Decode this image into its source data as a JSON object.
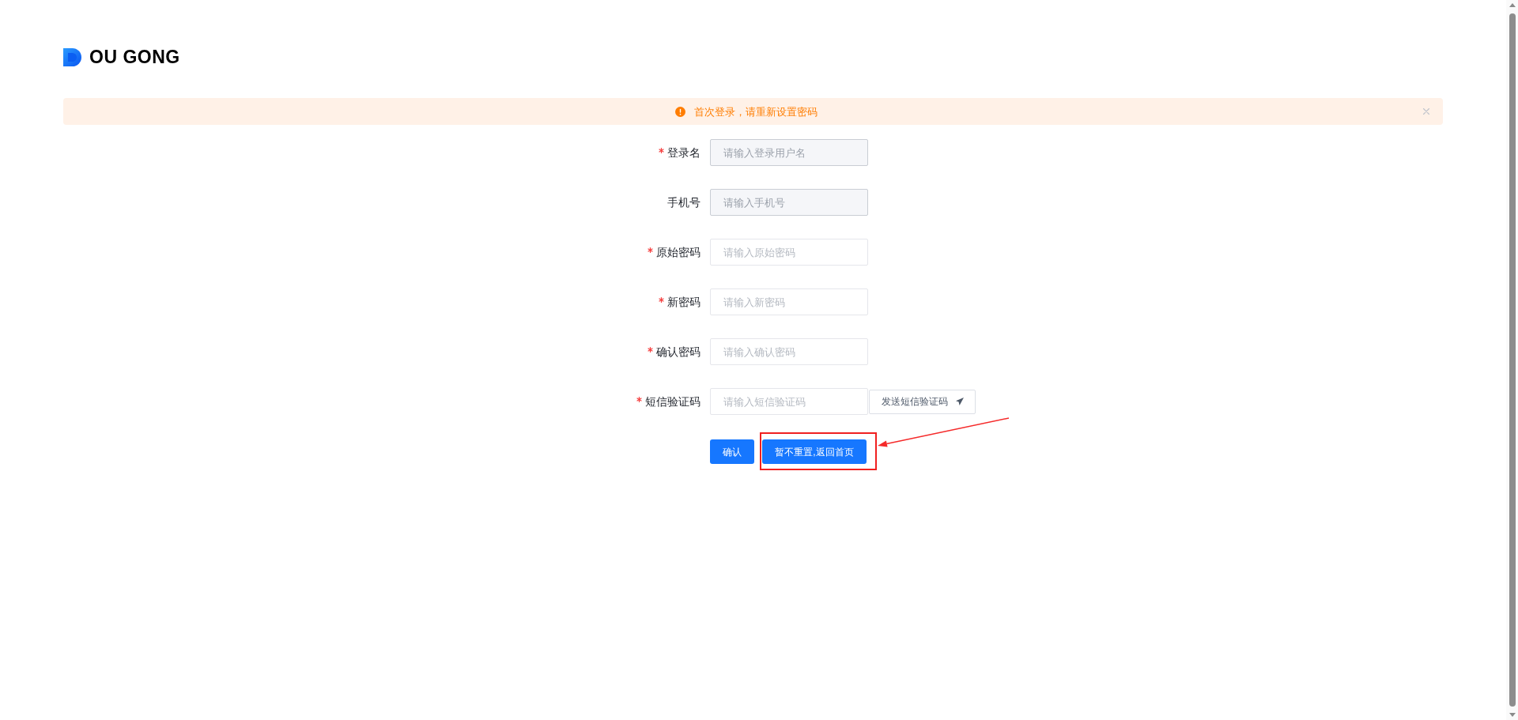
{
  "logo": {
    "text": "OU GONG"
  },
  "alert": {
    "message": "首次登录，请重新设置密码",
    "closable": true
  },
  "form": {
    "fields": [
      {
        "label": "登录名",
        "required": true,
        "disabled": true,
        "placeholder": "请输入登录用户名"
      },
      {
        "label": "手机号",
        "required": false,
        "disabled": true,
        "placeholder": "请输入手机号"
      },
      {
        "label": "原始密码",
        "required": true,
        "disabled": false,
        "placeholder": "请输入原始密码"
      },
      {
        "label": "新密码",
        "required": true,
        "disabled": false,
        "placeholder": "请输入新密码"
      },
      {
        "label": "确认密码",
        "required": true,
        "disabled": false,
        "placeholder": "请输入确认密码"
      },
      {
        "label": "短信验证码",
        "required": true,
        "disabled": false,
        "placeholder": "请输入短信验证码",
        "action": {
          "label": "发送短信验证码"
        }
      }
    ],
    "buttons": [
      {
        "label": "确认",
        "highlighted": false
      },
      {
        "label": "暂不重置,返回首页",
        "highlighted": true
      }
    ]
  }
}
